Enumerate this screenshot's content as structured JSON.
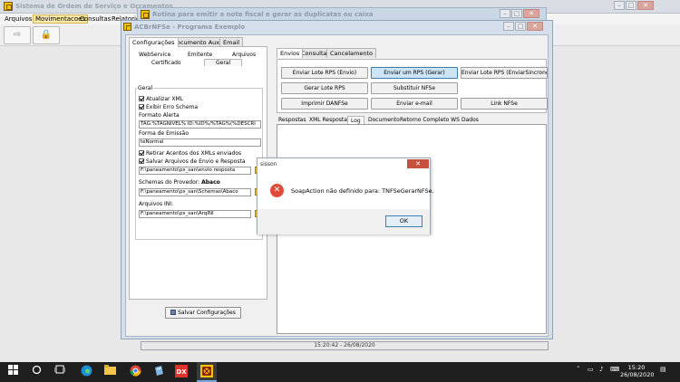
{
  "bg_app": {
    "title": "Sistema de Ordem de Serviço e Orçamentos",
    "menu": [
      "Arquivos",
      "Movimentacoes",
      "Consultas",
      "Relatorios"
    ],
    "bottom_text": "15:20:42 - 26/08/2020"
  },
  "win2": {
    "title": "Rotina para emitir a nota fiscal e gerar as duplicatas ou caixa"
  },
  "win3": {
    "title": "ACBrNFSe - Programa Exemplo",
    "left_tabs": [
      "Configurações",
      "Documento Auxiliar",
      "Email"
    ],
    "sub_tabs_row1": [
      "WebService",
      "Emitente",
      "Arquivos"
    ],
    "sub_tabs_row2": [
      "Certificado",
      "Geral"
    ],
    "group_title": "Geral",
    "chk_atualizar_xml": "Atualizar XML",
    "chk_exibir_erro": "Exibir Erro Schema",
    "formato_alerta_label": "Formato Alerta",
    "formato_alerta_value": "TAG:%TAGNIVEL% ID:%ID%/%TAG%(%DESCRI",
    "forma_emissao_label": "Forma de Emissão",
    "forma_emissao_value": "teNormal",
    "chk_retirar_acentos": "Retirar Acentos dos XMLs enviados",
    "chk_salvar_arquivos": "Salvar Arquivos de Envio e Resposta",
    "envio_path": "F:\\paneamento\\ps_san\\envio resposta",
    "schemas_label": "Schemas do Provedor:",
    "schemas_provider": "Abaco",
    "schemas_path": "F:\\paneamento\\ps_san\\Schemas\\Abaco",
    "arquivos_ini_label": "Arquivos INI:",
    "arquivos_ini_path": "F:\\paneamento\\ps_san\\ArqINI",
    "save_label": "Salvar Configurações",
    "right_tabs": [
      "Envios",
      "Consultas",
      "Cancelamento"
    ],
    "buttons": {
      "enviar_lote_envio": "Enviar Lote RPS (Envio)",
      "enviar_um_rps": "Enviar um RPS (Gerar)",
      "enviar_lote_sincrono": "Enviar Lote RPS (EnviarSincrono)",
      "gerar_lote": "Gerar Lote RPS",
      "substituir": "Substituir NFSe",
      "imprimir": "Imprimir DANFSe",
      "enviar_email": "Enviar e-mail",
      "link": "Link NFSe"
    },
    "result_tabs": [
      "Respostas",
      "XML Resposta",
      "Log",
      "Documento",
      "Retorno Completo WS",
      "Dados"
    ]
  },
  "dialog": {
    "title": "sisson",
    "message": "SoapAction não definido para: TNFSeGerarNFSe.",
    "ok_label": "OK"
  },
  "taskbar": {
    "time": "15:20",
    "date": "26/08/2020",
    "icons": [
      "windows-start-icon",
      "search-icon",
      "task-view-icon",
      "edge-icon",
      "file-explorer-icon",
      "chrome-icon",
      "app-icon",
      "anydesk-icon",
      "delphi-icon"
    ]
  }
}
